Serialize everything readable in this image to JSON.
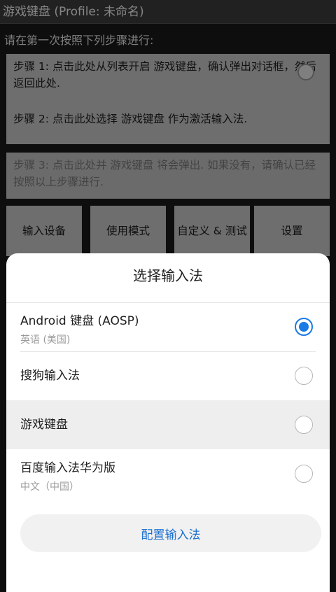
{
  "titlebar": {
    "title": "游戏键盘 (Profile: 未命名)"
  },
  "main": {
    "instruction": "请在第一次按照下列步骤进行:",
    "steps": [
      {
        "text": "步骤 1: 点击此处从列表开启 游戏键盘，确认弹出对话框，然后返回此处."
      },
      {
        "text": "步骤 2: 点击此处选择 游戏键盘 作为激活输入法."
      },
      {
        "text": "步骤 3: 点击此处并 游戏键盘 将会弹出. 如果没有，请确认已经按照以上步骤进行."
      }
    ],
    "tabs": [
      {
        "label": "输入设备"
      },
      {
        "label": "使用模式"
      },
      {
        "label": "自定义 & 测试"
      },
      {
        "label": "设置"
      }
    ]
  },
  "dialog": {
    "title": "选择输入法",
    "options": [
      {
        "name": "Android 键盘 (AOSP)",
        "sub": "英语 (美国)",
        "selected": true
      },
      {
        "name": "搜狗输入法",
        "sub": "",
        "selected": false
      },
      {
        "name": "游戏键盘",
        "sub": "",
        "selected": false
      },
      {
        "name": "百度输入法华为版",
        "sub": "中文（中国）",
        "selected": false
      }
    ],
    "configure_label": "配置输入法"
  },
  "colors": {
    "accent": "#1a7ae6",
    "link": "#1a6fd1"
  }
}
